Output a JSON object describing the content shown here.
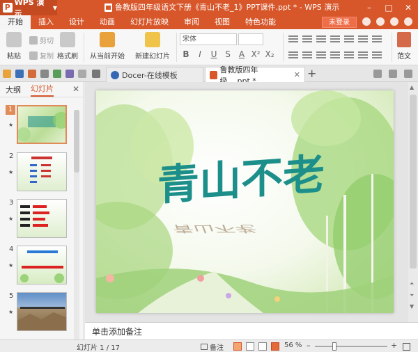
{
  "app": {
    "logo_letter": "P",
    "name": "WPS 演示",
    "title": "鲁教版四年级语文下册《青山不老_1》PPT课件.ppt * - WPS 演示"
  },
  "menu": {
    "items": [
      "开始",
      "插入",
      "设计",
      "动画",
      "幻灯片放映",
      "审阅",
      "视图",
      "特色功能"
    ],
    "login": "未登录"
  },
  "ribbon": {
    "paste": "粘贴",
    "cut": "剪切",
    "copy": "复制",
    "format_painter": "格式刷",
    "from_current": "从当前开始",
    "new_slide": "新建幻灯片",
    "font_name": "宋体",
    "template": "范文"
  },
  "tabs": [
    {
      "label": "Docer-在线模板"
    },
    {
      "label": "鲁教版四年级....ppt *"
    }
  ],
  "panel": {
    "tabs": [
      "大纲",
      "幻灯片"
    ]
  },
  "thumbnails": [
    {
      "num": "1"
    },
    {
      "num": "2"
    },
    {
      "num": "3"
    },
    {
      "num": "4"
    },
    {
      "num": "5"
    }
  ],
  "slide": {
    "title": "青山不老"
  },
  "notes": {
    "placeholder": "单击添加备注"
  },
  "status": {
    "slide_counter": "幻灯片 1 / 17",
    "notes": "备注",
    "zoom": "56 %"
  },
  "colors": {
    "accent": "#d7562a",
    "title_teal": "#1d8f8a"
  }
}
